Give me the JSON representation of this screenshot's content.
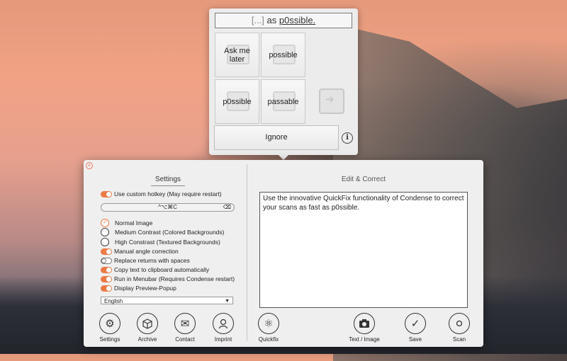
{
  "popup": {
    "title_bracket": "[...]",
    "title_mid": " as ",
    "title_word": "p0ssible.",
    "tiles": [
      "Ask me later",
      "possible",
      "p0ssible",
      "passable"
    ],
    "ignore_label": "Ignore",
    "info_label": "i"
  },
  "window": {
    "close_label": "×",
    "settings": {
      "title": "Settings",
      "custom_hotkey": "Use custom hotkey (May require restart)",
      "hotkey_value": "^⌥⌘C",
      "hotkey_clear": "⌫",
      "normal_image": "Normal Image",
      "medium_contrast": "Medium Contrast (Colored Backgrounds)",
      "high_contrast": "High Constrast (Textured Backgrounds)",
      "manual_angle": "Manual angle correction",
      "replace_returns": "Replace returns with spaces",
      "copy_clipboard": "Copy text to clipboard automatically",
      "run_menubar": "Run in Menubar (Requires Condense restart)",
      "display_preview": "Display Preview-Popup",
      "language": "English",
      "language_arrow": "▼"
    },
    "toolbar_left": [
      "Settings",
      "Archive",
      "Contact",
      "Imprint"
    ],
    "toolbar_right": [
      "Quickfix",
      "Text / Image",
      "Save",
      "Scan"
    ],
    "edit": {
      "title": "Edit & Correct",
      "text": "Use the innovative QuickFix functionality of Condense to correct your scans as fast as p0ssible."
    }
  },
  "icons": {
    "settings": "gear-icon",
    "archive": "box-icon",
    "contact": "envelope-icon",
    "imprint": "person-icon",
    "quickfix": "atom-icon",
    "text_image": "camera-icon",
    "save": "checkmark-icon",
    "scan": "circle-icon"
  },
  "colors": {
    "accent": "#ec7a45"
  }
}
